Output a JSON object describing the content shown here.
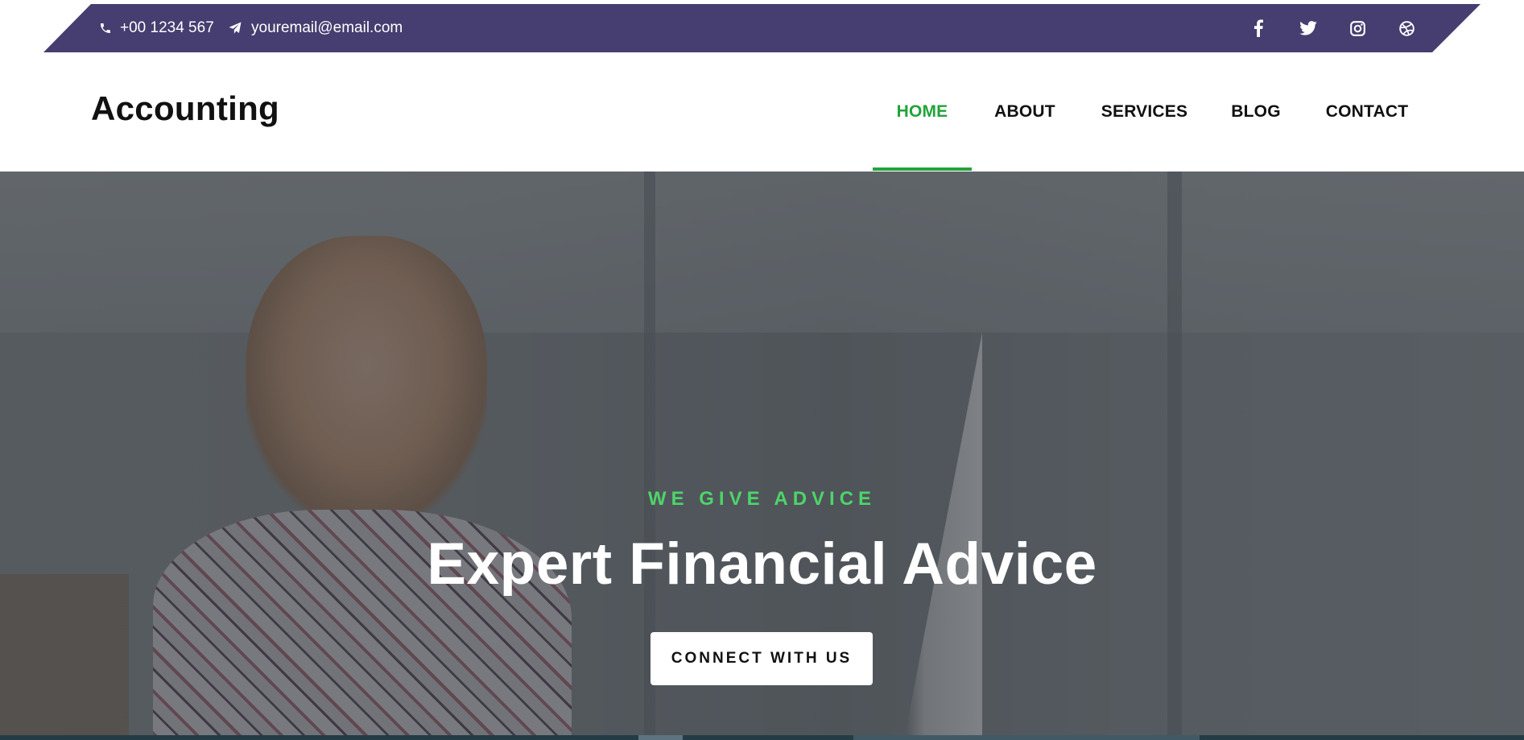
{
  "topbar": {
    "phone": "+00 1234 567",
    "email": "youremail@email.com",
    "phone_icon": "phone-icon",
    "email_icon": "paper-plane-icon",
    "social": [
      "facebook-icon",
      "twitter-icon",
      "instagram-icon",
      "dribbble-icon"
    ],
    "color": "#463d70"
  },
  "header": {
    "logo": "Accounting",
    "nav": [
      {
        "label": "HOME",
        "active": true
      },
      {
        "label": "ABOUT",
        "active": false
      },
      {
        "label": "SERVICES",
        "active": false
      },
      {
        "label": "BLOG",
        "active": false
      },
      {
        "label": "CONTACT",
        "active": false
      }
    ],
    "accent": "#22a33a"
  },
  "hero": {
    "eyebrow": "WE GIVE ADVICE",
    "title": "Expert Financial Advice",
    "cta": "CONNECT WITH US",
    "eyebrow_color": "#4ed46a"
  }
}
